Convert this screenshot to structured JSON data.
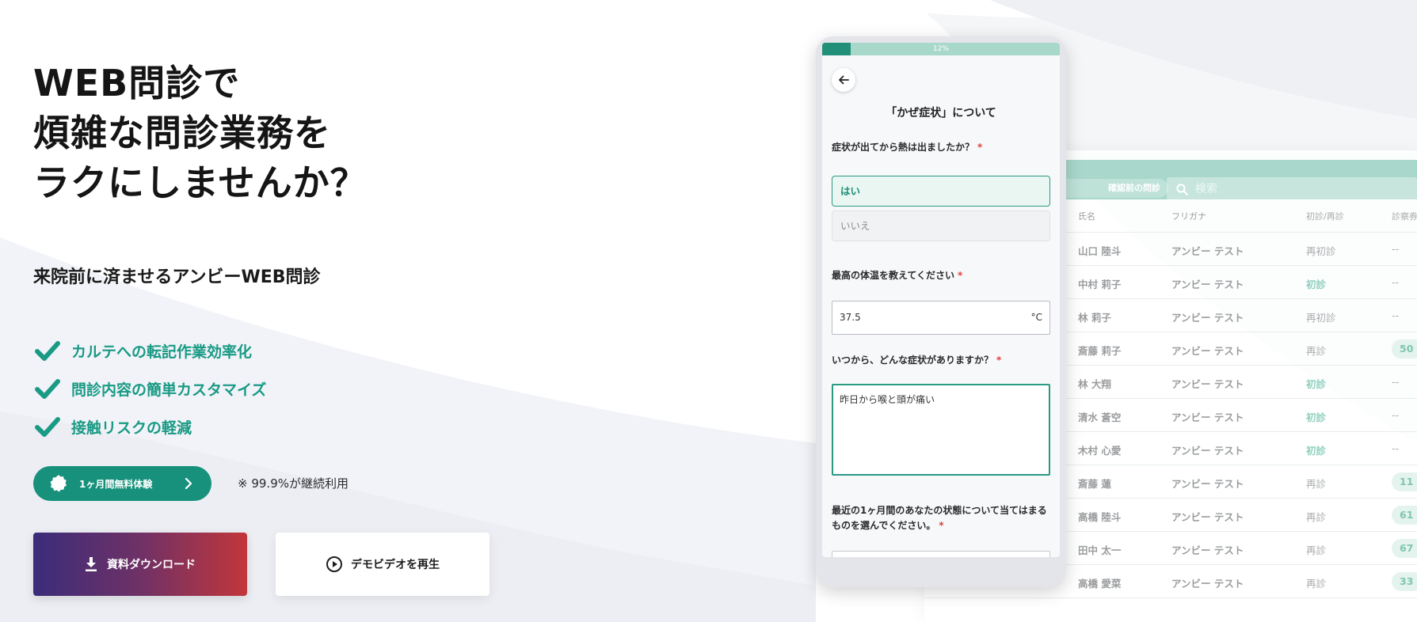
{
  "hero": {
    "title_lines": [
      "WEB問診で",
      "煩雑な問診業務を",
      "ラクにしませんか？"
    ],
    "subtitle": "来院前に済ませるアンビーWEB問診",
    "features": [
      "カルテへの転記作業効率化",
      "問診内容の簡単カスタマイズ",
      "接触リスクの軽減"
    ],
    "trial_button": "1ヶ月間無料体験",
    "trial_note": "※ 99.9%が継続利用",
    "download_button": "資料ダウンロード",
    "video_button": "デモビデオを再生",
    "colors": {
      "accent": "#17917c",
      "gradient_start": "#3b2c7a",
      "gradient_end": "#c2363b"
    }
  },
  "phone": {
    "progress_label": "12%",
    "progress_value": 0.12,
    "heading": "「かぜ症状」について",
    "q1": {
      "label": "症状が出てから熱は出ましたか？",
      "required_mark": "*",
      "options": [
        "はい",
        "いいえ"
      ],
      "selected": "はい"
    },
    "q2": {
      "label": "最高の体温を教えてください",
      "required_mark": "*",
      "value": "37.5",
      "unit": "°C"
    },
    "q3": {
      "label": "いつから、どんな症状がありますか？",
      "required_mark": "*",
      "value": "昨日から喉と頭が痛い"
    },
    "q4": {
      "label": "最近の1ヶ月間のあなたの状態について当てはまるものを選んでください。",
      "required_mark": "*"
    }
  },
  "dashboard": {
    "filter_pill": "確認前の問診",
    "search_placeholder": "検索",
    "columns": [
      "氏名",
      "フリガナ",
      "初診/再診",
      "診察券"
    ],
    "rows": [
      {
        "name": "山口 陸斗",
        "kana": "アンビー テスト",
        "type": "再初診",
        "num": "--"
      },
      {
        "name": "中村 莉子",
        "kana": "アンビー テスト",
        "type": "初診",
        "num": "--"
      },
      {
        "name": "林 莉子",
        "kana": "アンビー テスト",
        "type": "再初診",
        "num": "--"
      },
      {
        "name": "斎藤 莉子",
        "kana": "アンビー テスト",
        "type": "再診",
        "num": "50"
      },
      {
        "name": "林 大翔",
        "kana": "アンビー テスト",
        "type": "初診",
        "num": "--"
      },
      {
        "name": "清水 蒼空",
        "kana": "アンビー テスト",
        "type": "初診",
        "num": "--"
      },
      {
        "name": "木村 心愛",
        "kana": "アンビー テスト",
        "type": "初診",
        "num": "--"
      },
      {
        "name": "斎藤 蓮",
        "kana": "アンビー テスト",
        "type": "再診",
        "num": "11"
      },
      {
        "name": "高橋 陸斗",
        "kana": "アンビー テスト",
        "type": "再診",
        "num": "61"
      },
      {
        "name": "田中 太一",
        "kana": "アンビー テスト",
        "type": "再診",
        "num": "67"
      },
      {
        "name": "高橋 愛菜",
        "kana": "アンビー テスト",
        "type": "再診",
        "num": "33"
      }
    ]
  }
}
